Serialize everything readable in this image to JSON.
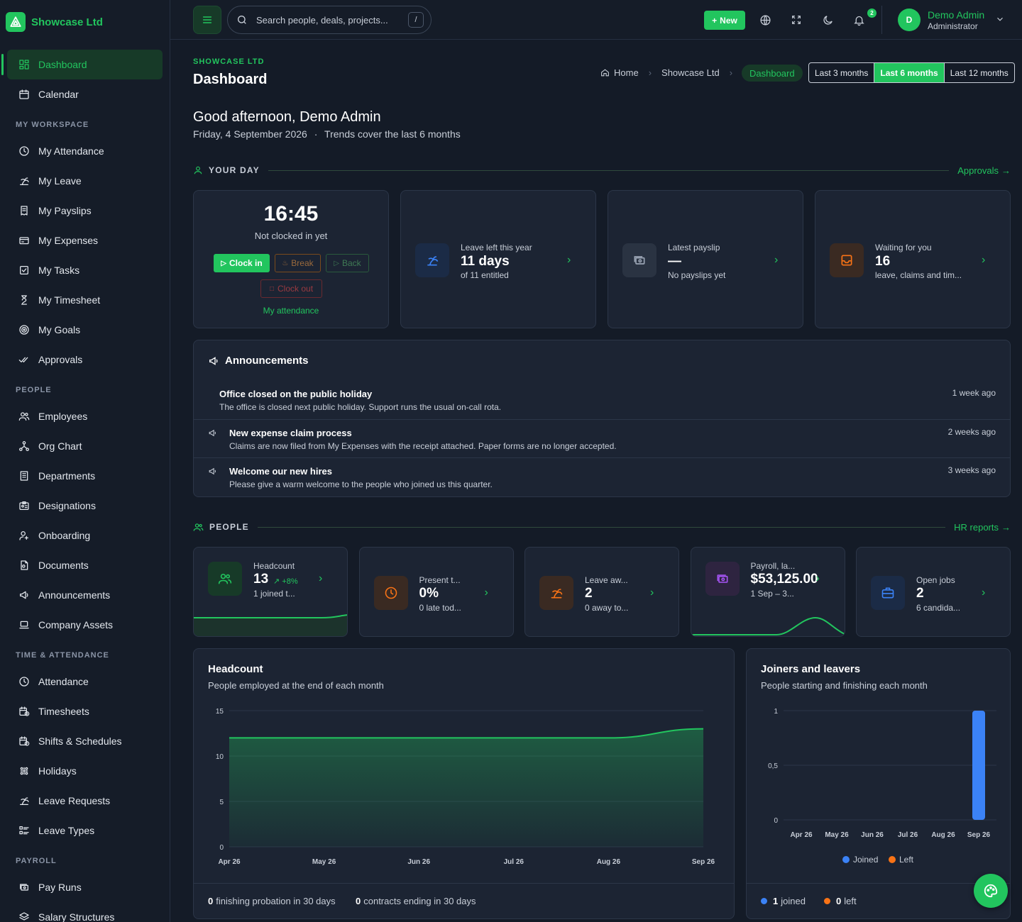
{
  "brand": {
    "name": "Showcase Ltd"
  },
  "sidebar": {
    "top": [
      {
        "label": "Dashboard",
        "icon": "dashboard-icon",
        "active": true
      },
      {
        "label": "Calendar",
        "icon": "calendar-icon"
      }
    ],
    "sections": [
      {
        "title": "MY WORKSPACE",
        "items": [
          {
            "label": "My Attendance",
            "icon": "clock-icon"
          },
          {
            "label": "My Leave",
            "icon": "beach-icon"
          },
          {
            "label": "My Payslips",
            "icon": "receipt-icon"
          },
          {
            "label": "My Expenses",
            "icon": "card-icon"
          },
          {
            "label": "My Tasks",
            "icon": "checkbox-icon"
          },
          {
            "label": "My Timesheet",
            "icon": "hourglass-icon"
          },
          {
            "label": "My Goals",
            "icon": "target-icon"
          },
          {
            "label": "Approvals",
            "icon": "double-check-icon"
          }
        ]
      },
      {
        "title": "PEOPLE",
        "items": [
          {
            "label": "Employees",
            "icon": "users-icon"
          },
          {
            "label": "Org Chart",
            "icon": "org-chart-icon"
          },
          {
            "label": "Departments",
            "icon": "building-icon"
          },
          {
            "label": "Designations",
            "icon": "id-badge-icon"
          },
          {
            "label": "Onboarding",
            "icon": "user-plus-icon"
          },
          {
            "label": "Documents",
            "icon": "document-icon"
          },
          {
            "label": "Announcements",
            "icon": "megaphone-icon"
          },
          {
            "label": "Company Assets",
            "icon": "laptop-icon"
          }
        ]
      },
      {
        "title": "TIME & ATTENDANCE",
        "items": [
          {
            "label": "Attendance",
            "icon": "clock-icon"
          },
          {
            "label": "Timesheets",
            "icon": "calendar-clock-icon"
          },
          {
            "label": "Shifts & Schedules",
            "icon": "calendar-time-icon"
          },
          {
            "label": "Holidays",
            "icon": "sparkle-icon"
          },
          {
            "label": "Leave Requests",
            "icon": "beach-icon"
          },
          {
            "label": "Leave Types",
            "icon": "list-icon"
          }
        ]
      },
      {
        "title": "PAYROLL",
        "items": [
          {
            "label": "Pay Runs",
            "icon": "cash-icon"
          },
          {
            "label": "Salary Structures",
            "icon": "layers-icon"
          }
        ]
      }
    ]
  },
  "topbar": {
    "search_placeholder": "Search people, deals, projects...",
    "search_shortcut": "/",
    "new_label": "New",
    "notifications_count": "2",
    "user_initial": "D",
    "user_name": "Demo Admin",
    "user_role": "Administrator"
  },
  "header": {
    "company": "SHOWCASE LTD",
    "title": "Dashboard",
    "breadcrumb": {
      "home": "Home",
      "company": "Showcase Ltd",
      "current": "Dashboard"
    },
    "ranges": [
      "Last 3 months",
      "Last 6 months",
      "Last 12 months"
    ],
    "active_range": "Last 6 months"
  },
  "greeting": {
    "title": "Good afternoon, Demo Admin",
    "date": "Friday, 4 September 2026",
    "sep": "·",
    "trend_note": "Trends cover the last 6 months"
  },
  "your_day": {
    "heading": "YOUR DAY",
    "link": "Approvals",
    "clock": {
      "time": "16:45",
      "status": "Not clocked in yet",
      "clock_in": "Clock in",
      "break": "Break",
      "back": "Back",
      "clock_out": "Clock out",
      "link": "My attendance"
    },
    "leave": {
      "label": "Leave left this year",
      "value": "11 days",
      "sub": "of 11 entitled"
    },
    "payslip": {
      "label": "Latest payslip",
      "value": "—",
      "sub": "No payslips yet"
    },
    "waiting": {
      "label": "Waiting for you",
      "value": "16",
      "sub": "leave, claims and tim..."
    }
  },
  "announcements": {
    "title": "Announcements",
    "items": [
      {
        "title": "Office closed on the public holiday",
        "text": "The office is closed next public holiday. Support runs the usual on-call rota.",
        "time": "1 week ago"
      },
      {
        "title": "New expense claim process",
        "text": "Claims are now filed from My Expenses with the receipt attached. Paper forms are no longer accepted.",
        "time": "2 weeks ago"
      },
      {
        "title": "Welcome our new hires",
        "text": "Please give a warm welcome to the people who joined us this quarter.",
        "time": "3 weeks ago"
      }
    ]
  },
  "people": {
    "heading": "PEOPLE",
    "link": "HR reports",
    "cards": [
      {
        "label": "Headcount",
        "value": "13",
        "delta": "+8%",
        "sub": "1 joined t..."
      },
      {
        "label": "Present t...",
        "value": "0%",
        "sub": "0 late tod..."
      },
      {
        "label": "Leave aw...",
        "value": "2",
        "sub": "0 away to..."
      },
      {
        "label": "Payroll, la...",
        "value": "$53,125.00",
        "sub": "1 Sep – 3..."
      },
      {
        "label": "Open jobs",
        "value": "2",
        "sub": "6 candida..."
      }
    ]
  },
  "colors": {
    "accent": "#22c55e",
    "joined": "#3b82f6",
    "left": "#f97316"
  },
  "headcount_chart": {
    "title": "Headcount",
    "subtitle": "People employed at the end of each month",
    "footer": [
      {
        "value": "0",
        "text": "finishing probation in 30 days"
      },
      {
        "value": "0",
        "text": "contracts ending in 30 days"
      }
    ]
  },
  "joiners_chart": {
    "title": "Joiners and leavers",
    "subtitle": "People starting and finishing each month",
    "footer": [
      {
        "value": "1",
        "text": "joined"
      },
      {
        "value": "0",
        "text": "left"
      }
    ]
  },
  "chart_data": [
    {
      "type": "area",
      "title": "Headcount",
      "x": [
        "Apr 26",
        "May 26",
        "Jun 26",
        "Jul 26",
        "Aug 26",
        "Sep 26"
      ],
      "series": [
        {
          "values": [
            12,
            12,
            12,
            12,
            12,
            13
          ]
        }
      ],
      "ylim": [
        0,
        15
      ],
      "yticks": [
        0,
        5,
        10,
        15
      ],
      "grid": true
    },
    {
      "type": "bar",
      "title": "Joiners and leavers",
      "categories": [
        "Apr 26",
        "May 26",
        "Jun 26",
        "Jul 26",
        "Aug 26",
        "Sep 26"
      ],
      "series": [
        {
          "name": "Joined",
          "values": [
            0,
            0,
            0,
            0,
            0,
            1
          ]
        },
        {
          "name": "Left",
          "values": [
            0,
            0,
            0,
            0,
            0,
            0
          ]
        }
      ],
      "ylim": [
        0,
        1
      ],
      "yticks": [
        "0",
        "0,5",
        "1"
      ],
      "legend": "bottom",
      "grid": true
    }
  ]
}
